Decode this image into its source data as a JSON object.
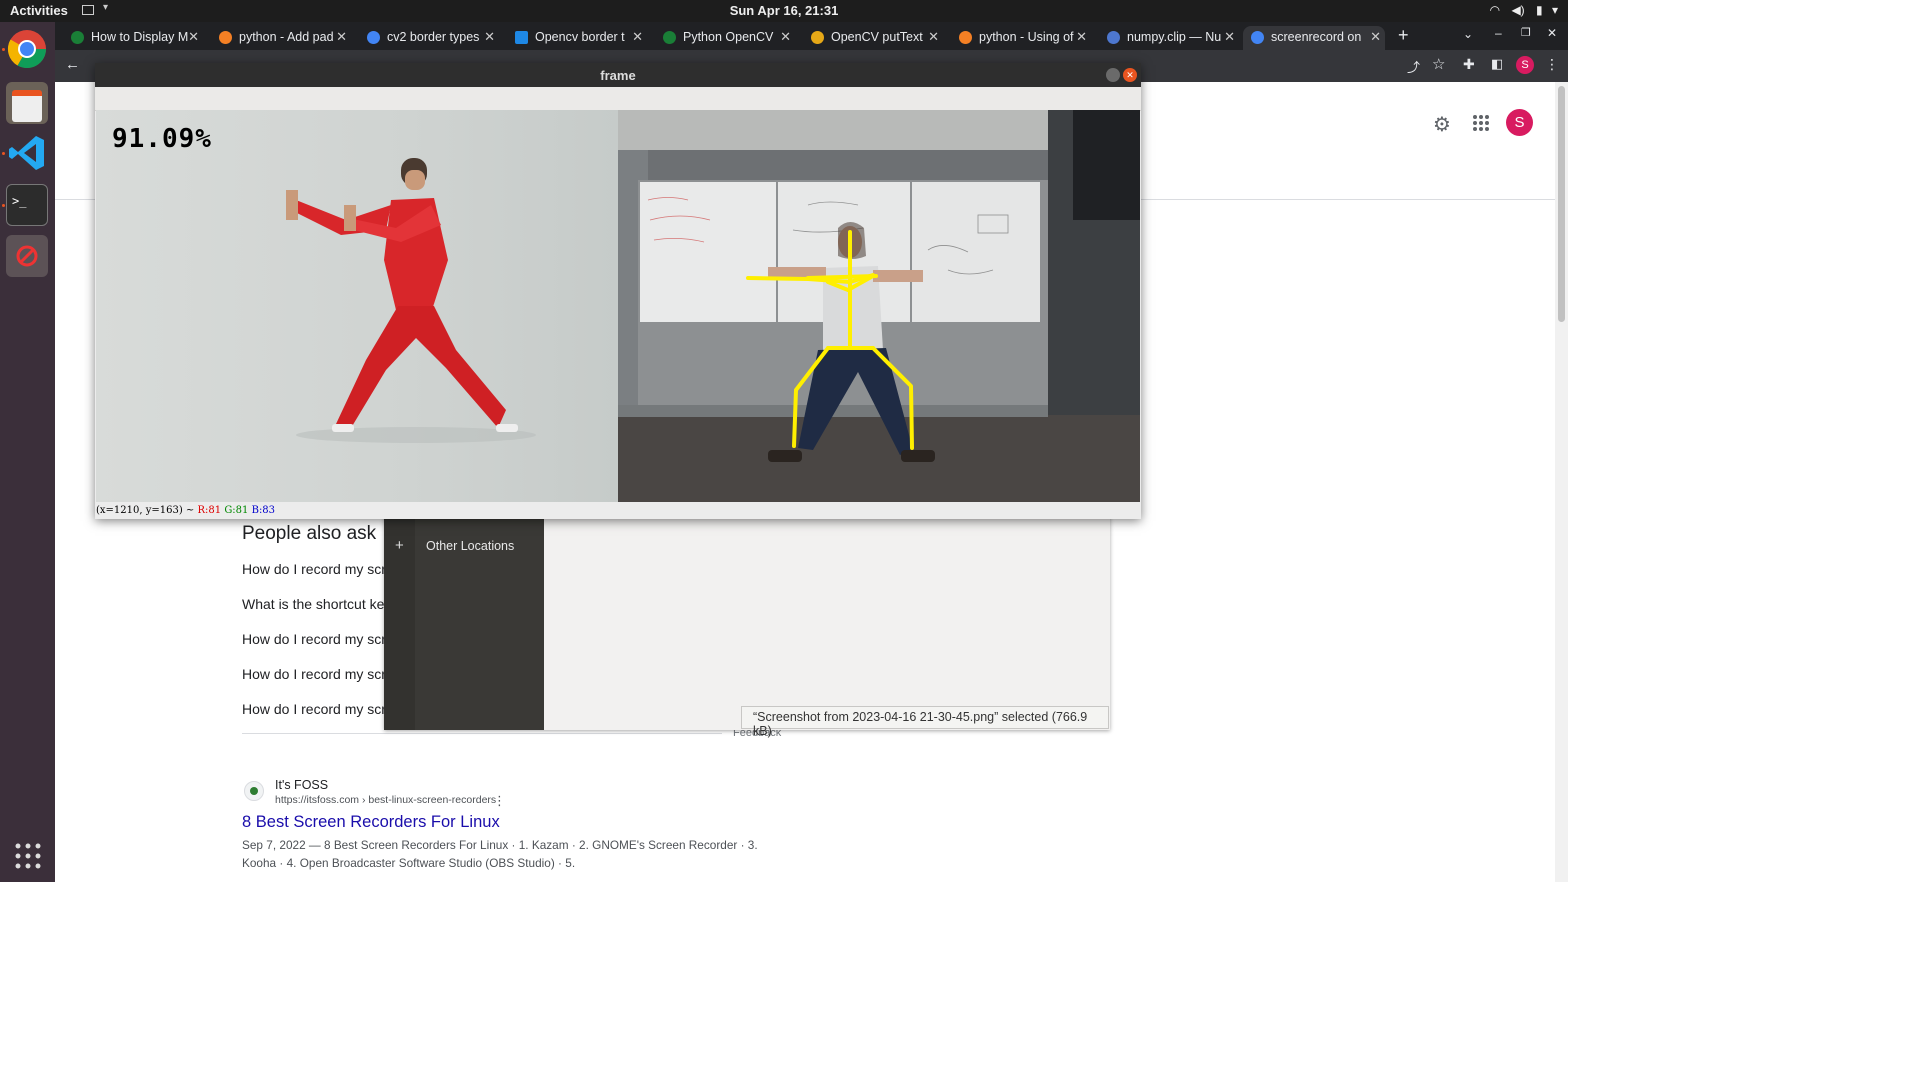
{
  "topbar": {
    "activities": "Activities",
    "clock": "Sun Apr 16, 21:31"
  },
  "tabs": [
    {
      "label": "How to Display M",
      "fav_color": "#1a7f37"
    },
    {
      "label": "python - Add pad",
      "fav_color": "#f48024"
    },
    {
      "label": "cv2 border types",
      "fav_color": "#4285f4"
    },
    {
      "label": "Opencv border t",
      "fav_color": "#1e88e5"
    },
    {
      "label": "Python OpenCV",
      "fav_color": "#1a7f37"
    },
    {
      "label": "OpenCV putText",
      "fav_color": "#e6a817"
    },
    {
      "label": "python - Using of",
      "fav_color": "#f48024"
    },
    {
      "label": "numpy.clip — Nu",
      "fav_color": "#4d77cf"
    },
    {
      "label": "screenrecord on",
      "fav_color": "#4285f4"
    }
  ],
  "cv_window": {
    "title": "frame",
    "accuracy_overlay": "91.09%",
    "status_prefix": "(x=1210, y=163) ~",
    "status_r": "R:81",
    "status_g": "G:81",
    "status_b": "B:83"
  },
  "search": {
    "paa_title": "People also ask",
    "questions": [
      "How do I record my scre",
      "What is the shortcut key",
      "How do I record my scre",
      "How do I record my scre",
      "How do I record my scre"
    ],
    "feedback": "Feedback",
    "result_site": "It's FOSS",
    "result_url": "https://itsfoss.com › best-linux-screen-recorders",
    "result_title": "8 Best Screen Recorders For Linux",
    "result_snippet_1": "Sep 7, 2022 — 8 Best Screen Recorders For Linux · 1. Kazam · 2. GNOME's Screen Recorder · 3.",
    "result_snippet_2": "Kooha · 4. Open Broadcaster Software Studio (OBS Studio) · 5."
  },
  "dialog": {
    "other_locations": "Other Locations",
    "status": "“Screenshot from 2023-04-16 21-30-45.png” selected  (766.9 kB)"
  },
  "avatar_letter": "S",
  "colors": {
    "accent_red": "#d93025",
    "link_blue": "#1a0dab",
    "skeleton": "#ffef00"
  }
}
